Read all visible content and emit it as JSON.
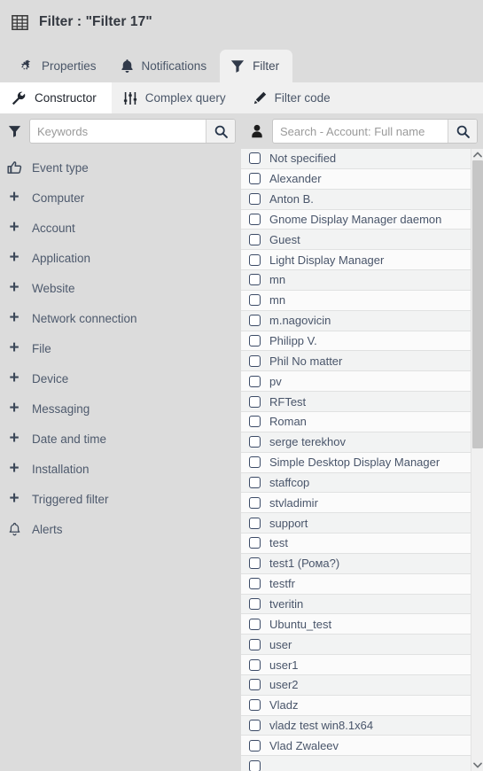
{
  "window": {
    "icon": "grid-table-icon",
    "title": "Filter : \"Filter 17\""
  },
  "tabs": [
    {
      "id": "properties",
      "label": "Properties",
      "icon": "gears-icon",
      "active": false
    },
    {
      "id": "notifications",
      "label": "Notifications",
      "icon": "bell-icon",
      "active": false
    },
    {
      "id": "filter",
      "label": "Filter",
      "icon": "funnel-icon",
      "active": true
    }
  ],
  "subtabs": [
    {
      "id": "constructor",
      "label": "Constructor",
      "icon": "wrench-icon",
      "active": true
    },
    {
      "id": "complex-query",
      "label": "Complex query",
      "icon": "sliders-icon",
      "active": false
    },
    {
      "id": "filter-code",
      "label": "Filter code",
      "icon": "pencil-icon",
      "active": false
    }
  ],
  "left_panel": {
    "search": {
      "icon": "funnel-icon",
      "placeholder": "Keywords",
      "value": "",
      "button_icon": "search-icon"
    },
    "items": [
      {
        "label": "Event type",
        "icon": "thumbs-up-icon",
        "expander": false
      },
      {
        "label": "Computer",
        "icon": "plus-icon",
        "expander": true
      },
      {
        "label": "Account",
        "icon": "plus-icon",
        "expander": true
      },
      {
        "label": "Application",
        "icon": "plus-icon",
        "expander": true
      },
      {
        "label": "Website",
        "icon": "plus-icon",
        "expander": true
      },
      {
        "label": "Network connection",
        "icon": "plus-icon",
        "expander": true
      },
      {
        "label": "File",
        "icon": "plus-icon",
        "expander": true
      },
      {
        "label": "Device",
        "icon": "plus-icon",
        "expander": true
      },
      {
        "label": "Messaging",
        "icon": "plus-icon",
        "expander": true
      },
      {
        "label": "Date and time",
        "icon": "plus-icon",
        "expander": true
      },
      {
        "label": "Installation",
        "icon": "plus-icon",
        "expander": true
      },
      {
        "label": "Triggered filter",
        "icon": "plus-icon",
        "expander": true
      },
      {
        "label": "Alerts",
        "icon": "bell-icon",
        "expander": false
      }
    ]
  },
  "right_panel": {
    "search": {
      "icon": "person-icon",
      "placeholder": "Search - Account: Full name",
      "value": "",
      "button_icon": "search-icon"
    },
    "scrollbar": {
      "up_icon": "chevron-up-icon",
      "down_icon": "chevron-down-icon"
    },
    "options": [
      {
        "label": "Not specified",
        "checked": false
      },
      {
        "label": "Alexander",
        "checked": false
      },
      {
        "label": "Anton B.",
        "checked": false
      },
      {
        "label": "Gnome Display Manager daemon",
        "checked": false
      },
      {
        "label": "Guest",
        "checked": false
      },
      {
        "label": "Light Display Manager",
        "checked": false
      },
      {
        "label": "mn",
        "checked": false
      },
      {
        "label": "mn",
        "checked": false
      },
      {
        "label": "m.nagovicin",
        "checked": false
      },
      {
        "label": "Philipp V.",
        "checked": false
      },
      {
        "label": "Phil No matter",
        "checked": false
      },
      {
        "label": "pv",
        "checked": false
      },
      {
        "label": "RFTest",
        "checked": false
      },
      {
        "label": "Roman",
        "checked": false
      },
      {
        "label": "serge terekhov",
        "checked": false
      },
      {
        "label": "Simple Desktop Display Manager",
        "checked": false
      },
      {
        "label": "staffcop",
        "checked": false
      },
      {
        "label": "stvladimir",
        "checked": false
      },
      {
        "label": "support",
        "checked": false
      },
      {
        "label": "test",
        "checked": false
      },
      {
        "label": "test1 (Рома?)",
        "checked": false
      },
      {
        "label": "testfr",
        "checked": false
      },
      {
        "label": "tveritin",
        "checked": false
      },
      {
        "label": "Ubuntu_test",
        "checked": false
      },
      {
        "label": "user",
        "checked": false
      },
      {
        "label": "user1",
        "checked": false
      },
      {
        "label": "user2",
        "checked": false
      },
      {
        "label": "Vladz",
        "checked": false
      },
      {
        "label": "vladz test win8.1x64",
        "checked": false
      },
      {
        "label": "Vlad Zwaleev",
        "checked": false
      },
      {
        "label": "",
        "checked": false
      }
    ]
  },
  "colors": {
    "background": "#dcdcdc",
    "panel": "#f0f0f0",
    "list_odd": "#f2f3f3",
    "list_even": "#fbfbfb",
    "text": "#49556a",
    "title": "#333840",
    "checkbox_border": "#3b4a66"
  }
}
